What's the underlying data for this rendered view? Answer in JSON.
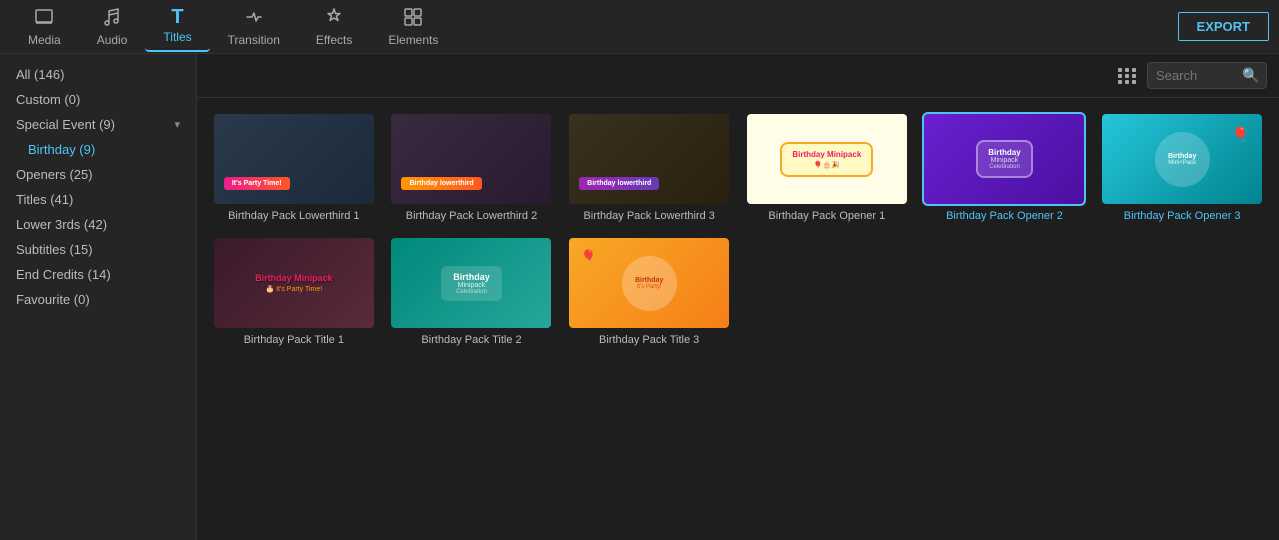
{
  "toolbar": {
    "export_label": "EXPORT",
    "items": [
      {
        "id": "media",
        "label": "Media",
        "icon": "🗂"
      },
      {
        "id": "audio",
        "label": "Audio",
        "icon": "♪"
      },
      {
        "id": "titles",
        "label": "Titles",
        "icon": "T"
      },
      {
        "id": "transition",
        "label": "Transition",
        "icon": "⇄"
      },
      {
        "id": "effects",
        "label": "Effects",
        "icon": "✦"
      },
      {
        "id": "elements",
        "label": "Elements",
        "icon": "🖼"
      }
    ]
  },
  "sidebar": {
    "items": [
      {
        "id": "all",
        "label": "All (146)",
        "indent": false,
        "active": false
      },
      {
        "id": "custom",
        "label": "Custom (0)",
        "indent": false,
        "active": false
      },
      {
        "id": "special-event",
        "label": "Special Event (9)",
        "indent": false,
        "active": false,
        "hasChevron": true
      },
      {
        "id": "birthday",
        "label": "Birthday (9)",
        "indent": true,
        "active": true
      },
      {
        "id": "openers",
        "label": "Openers (25)",
        "indent": false,
        "active": false
      },
      {
        "id": "titles",
        "label": "Titles (41)",
        "indent": false,
        "active": false
      },
      {
        "id": "lower3rds",
        "label": "Lower 3rds (42)",
        "indent": false,
        "active": false
      },
      {
        "id": "subtitles",
        "label": "Subtitles (15)",
        "indent": false,
        "active": false
      },
      {
        "id": "endcredits",
        "label": "End Credits (14)",
        "indent": false,
        "active": false
      },
      {
        "id": "favourite",
        "label": "Favourite (0)",
        "indent": false,
        "active": false
      }
    ]
  },
  "search": {
    "placeholder": "Search",
    "value": ""
  },
  "grid": {
    "items": [
      {
        "id": "lt1",
        "label": "Birthday Pack Lowerthird 1",
        "type": "lt1",
        "selected": false,
        "active": false
      },
      {
        "id": "lt2",
        "label": "Birthday Pack Lowerthird 2",
        "type": "lt2",
        "selected": false,
        "active": false
      },
      {
        "id": "lt3",
        "label": "Birthday Pack Lowerthird 3",
        "type": "lt3",
        "selected": false,
        "active": false
      },
      {
        "id": "op1",
        "label": "Birthday Pack Opener 1",
        "type": "op1",
        "selected": false,
        "active": false
      },
      {
        "id": "op2",
        "label": "Birthday Pack Opener 2",
        "type": "op2",
        "selected": true,
        "active": true
      },
      {
        "id": "op3",
        "label": "Birthday Pack Opener 3",
        "type": "op3",
        "selected": false,
        "active": true
      },
      {
        "id": "title1",
        "label": "Birthday Pack Title 1",
        "type": "title1",
        "selected": false,
        "active": false
      },
      {
        "id": "title2",
        "label": "Birthday Pack Title 2",
        "type": "title2",
        "selected": false,
        "active": false
      },
      {
        "id": "title3",
        "label": "Birthday Pack Title 3",
        "type": "title3",
        "selected": false,
        "active": false
      }
    ]
  }
}
